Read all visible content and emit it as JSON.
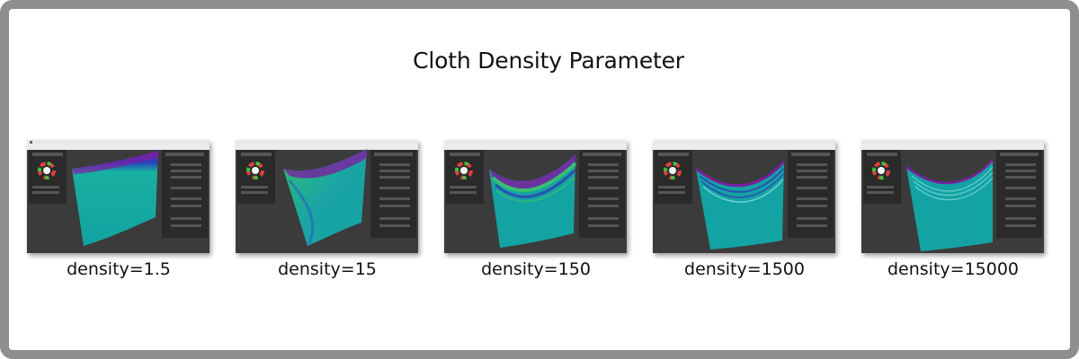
{
  "title": "Cloth Density Parameter",
  "panels": [
    {
      "caption": "density=1.5"
    },
    {
      "caption": "density=15"
    },
    {
      "caption": "density=150"
    },
    {
      "caption": "density=1500"
    },
    {
      "caption": "density=15000"
    }
  ],
  "colors": {
    "border": "#8e8e8e",
    "viewport_bg": "#3a3a3a",
    "cloth_teal": "#14a3a3",
    "cloth_purple": "#7a1fa0",
    "cloth_green": "#38c070"
  }
}
